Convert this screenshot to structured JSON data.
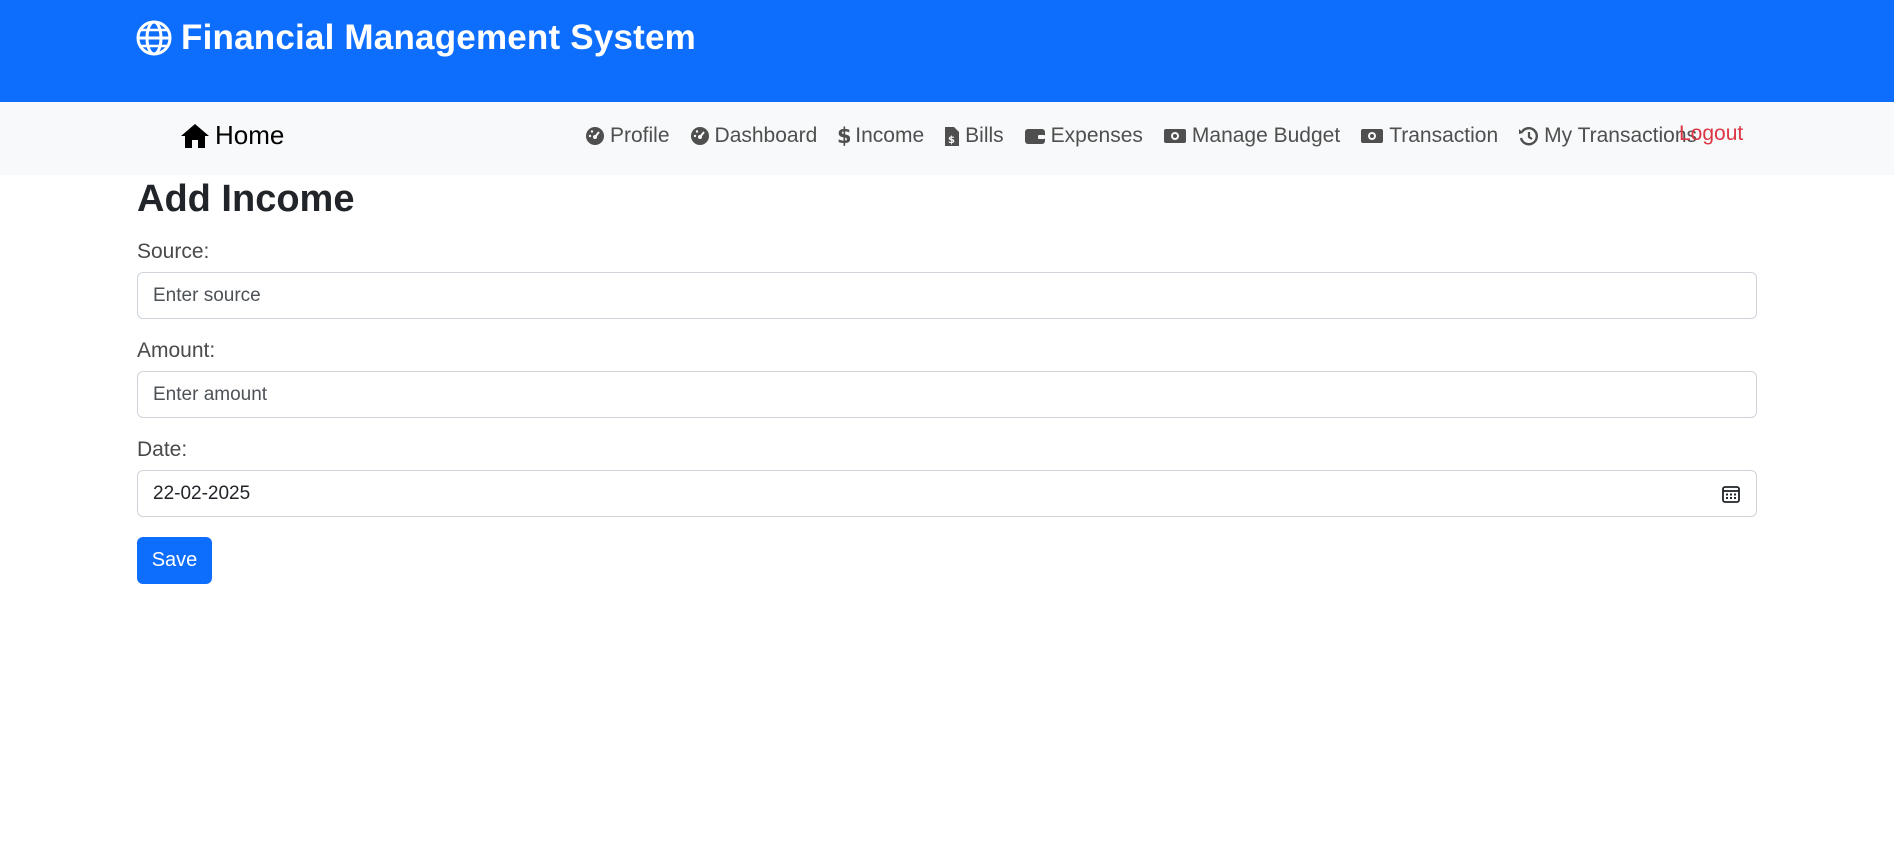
{
  "header": {
    "title": "Financial Management System",
    "icon": "globe-icon",
    "bg_color": "#0d6efd"
  },
  "nav": {
    "home": {
      "label": "Home",
      "icon": "house-icon"
    },
    "links": [
      {
        "label": "Profile",
        "icon": "gauge-icon"
      },
      {
        "label": "Dashboard",
        "icon": "gauge-icon"
      },
      {
        "label": "Income",
        "icon": "dollar-icon"
      },
      {
        "label": "Bills",
        "icon": "bill-file-icon"
      },
      {
        "label": "Expenses",
        "icon": "wallet-icon"
      },
      {
        "label": "Manage Budget",
        "icon": "money-bill-icon"
      },
      {
        "label": "Transaction",
        "icon": "money-bill-icon"
      },
      {
        "label": "My Transactions",
        "icon": "history-icon"
      }
    ],
    "logout": "Logout",
    "logout_color": "#dc3545"
  },
  "form": {
    "title": "Add Income",
    "source": {
      "label": "Source:",
      "placeholder": "Enter source",
      "value": ""
    },
    "amount": {
      "label": "Amount:",
      "placeholder": "Enter amount",
      "value": ""
    },
    "date": {
      "label": "Date:",
      "value": "22-02-2025"
    },
    "save_label": "Save",
    "accent_color": "#0d6efd"
  }
}
